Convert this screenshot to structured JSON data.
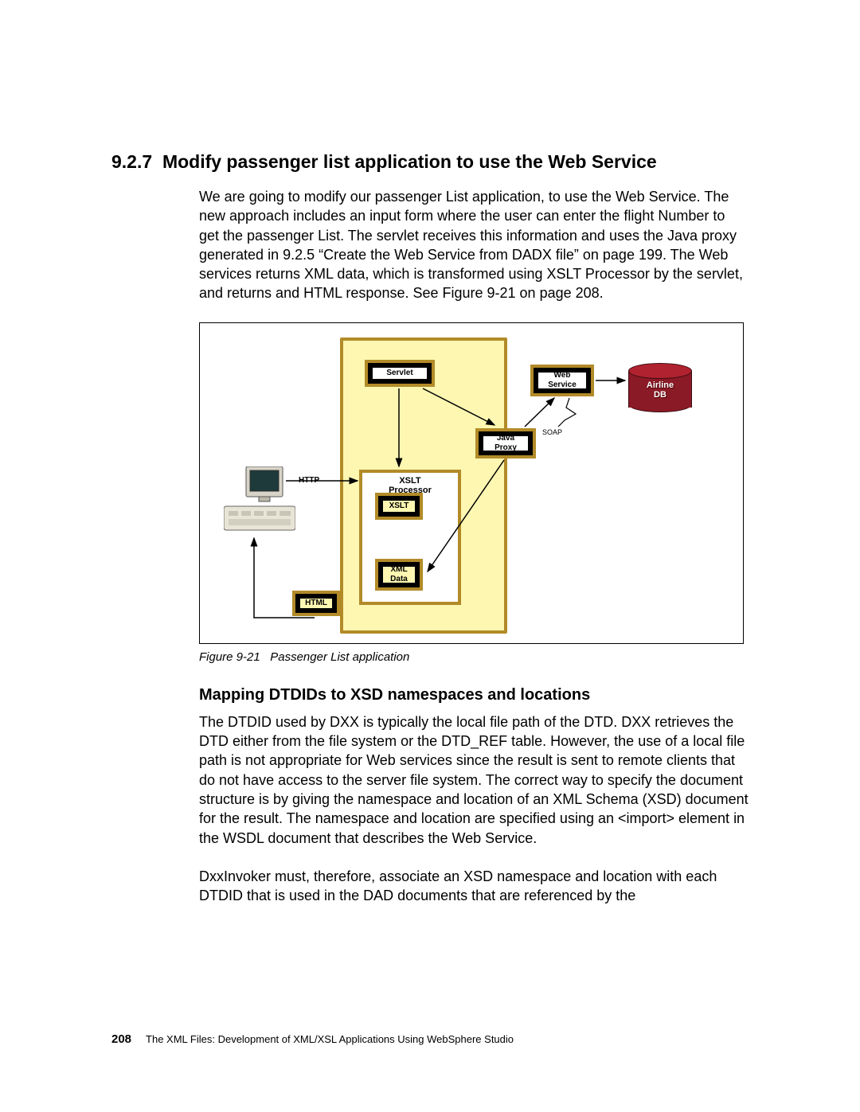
{
  "heading_number": "9.2.7",
  "heading_title": "Modify passenger list application to use the Web Service",
  "paragraph1": "We are going to modify our passenger List application, to use the Web Service. The new approach includes an input form where the user can enter the flight Number to get the passenger List. The servlet receives this information and uses the Java proxy generated in 9.2.5 “Create the Web Service from DADX file” on page 199. The Web services returns XML data, which is transformed using XSLT Processor by the servlet, and returns and HTML response. See Figure 9-21 on page 208.",
  "figure": {
    "caption_label": "Figure 9-21",
    "caption_text": "Passenger List application",
    "http_label": "HTTP",
    "soap_label": "SOAP",
    "boxes": {
      "servlet": "Servlet",
      "web_service": "Web\nService",
      "java_proxy": "Java\nProxy",
      "xslt_proc_header1": "XSLT",
      "xslt_proc_header2": "Processor",
      "xslt_file": "XSLT",
      "xml_data": "XML\nData",
      "html": "HTML"
    },
    "db_line1": "Airline",
    "db_line2": "DB"
  },
  "subheading": "Mapping DTDIDs to XSD namespaces and locations",
  "paragraph2": "The DTDID used by DXX is typically the local file path of the DTD. DXX retrieves the DTD either from the file system or the DTD_REF table. However, the use of a local file path is not appropriate for Web services since the result is sent to remote clients that do not have access to the server file system. The correct way to specify the document structure is by giving the namespace and location of an XML Schema (XSD) document for the result. The namespace and location are specified using an <import> element in the WSDL document that describes the Web Service.",
  "paragraph3": "DxxInvoker must, therefore, associate an XSD namespace and location with each DTDID that is used in the DAD documents that are referenced by the",
  "footer_page": "208",
  "footer_text": "The XML Files:   Development of XML/XSL Applications Using WebSphere Studio"
}
